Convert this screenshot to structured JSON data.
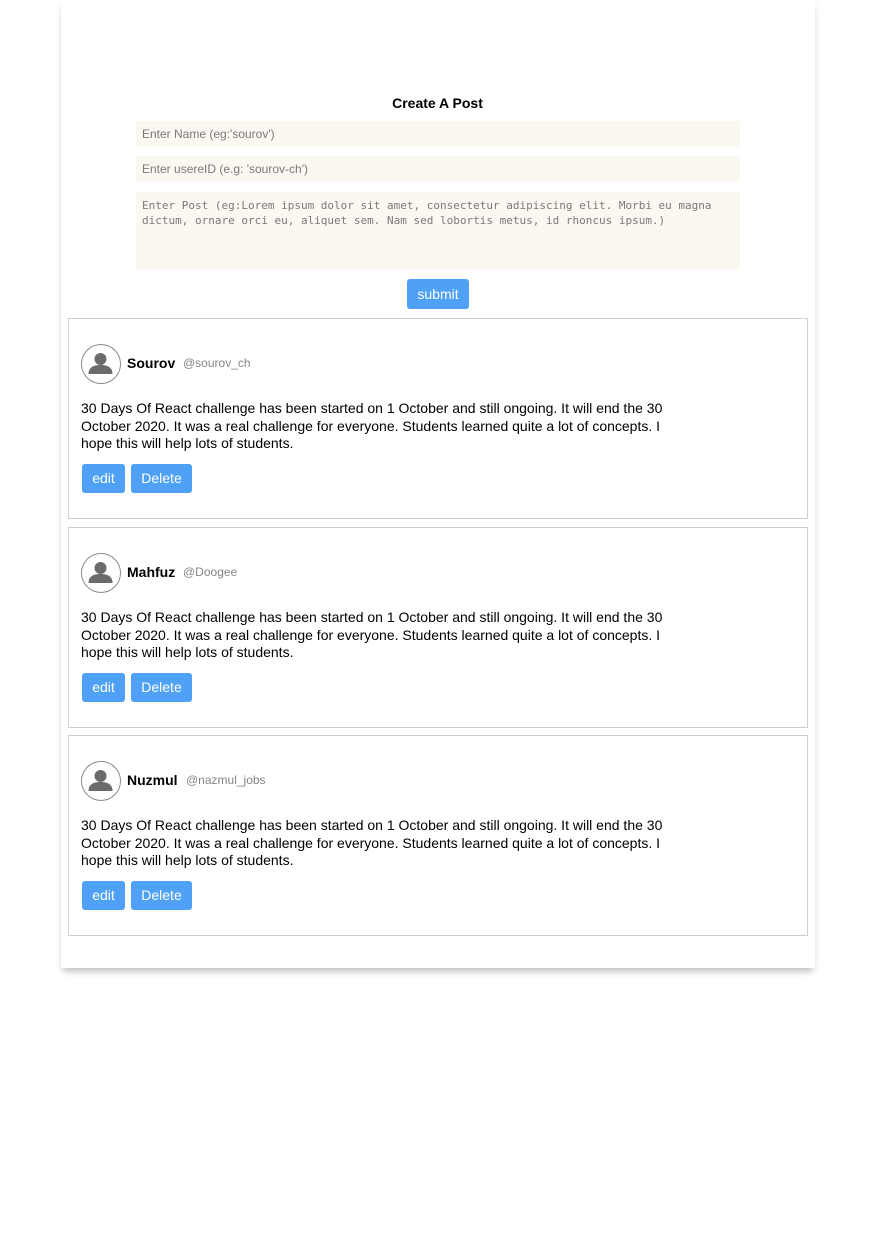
{
  "form": {
    "title": "Create A Post",
    "name_placeholder": "Enter Name (eg:'sourov')",
    "userid_placeholder": "Enter usereID (e.g: 'sourov-ch')",
    "post_placeholder": "Enter Post (eg:Lorem ipsum dolor sit amet, consectetur adipiscing elit. Morbi eu magna dictum, ornare orci eu, aliquet sem. Nam sed lobortis metus, id rhoncus ipsum.)",
    "submit_label": "submit"
  },
  "posts": [
    {
      "name": "Sourov",
      "handle": "@sourov_ch",
      "text": "30 Days Of React challenge has been started on 1 October and still ongoing. It will end the 30 October 2020. It was a real challenge for everyone. Students learned quite a lot of concepts. I hope this will help lots of students.",
      "edit_label": "edit",
      "delete_label": "Delete"
    },
    {
      "name": "Mahfuz",
      "handle": "@Doogee",
      "text": "30 Days Of React challenge has been started on 1 October and still ongoing. It will end the 30 October 2020. It was a real challenge for everyone. Students learned quite a lot of concepts. I hope this will help lots of students.",
      "edit_label": "edit",
      "delete_label": "Delete"
    },
    {
      "name": "Nuzmul",
      "handle": "@nazmul_jobs",
      "text": "30 Days Of React challenge has been started on 1 October and still ongoing. It will end the 30 October 2020. It was a real challenge for everyone. Students learned quite a lot of concepts. I hope this will help lots of students.",
      "edit_label": "edit",
      "delete_label": "Delete"
    }
  ],
  "colors": {
    "button": "#4ea1f5",
    "input_background": "#fbf7f1",
    "card_border": "#cfcfcf",
    "handle_text": "#858585"
  },
  "icons": {
    "avatar": "user-avatar-icon"
  }
}
